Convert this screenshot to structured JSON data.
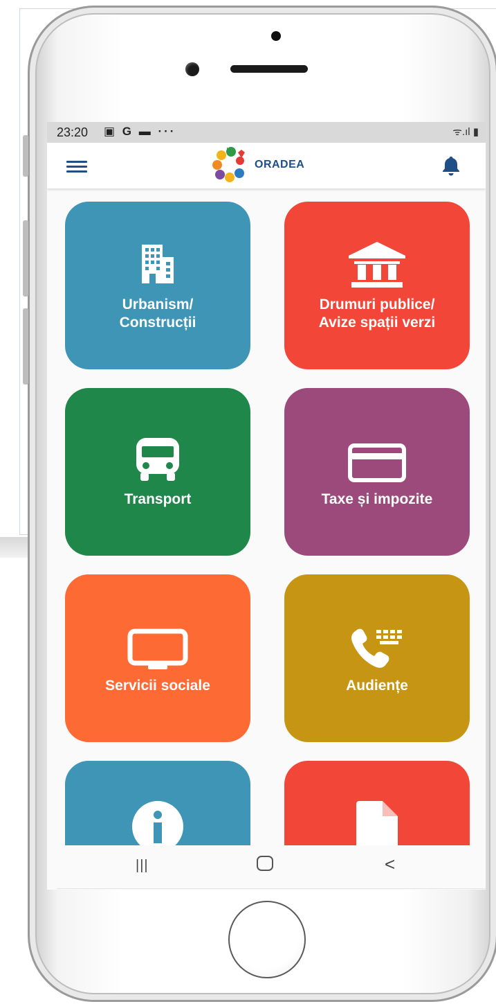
{
  "status_bar": {
    "time": "23:20",
    "left_icons": "▣ G ▬ ···",
    "right_icons": "ᯤ.ıl ▮"
  },
  "app_bar": {
    "logo_text": "ORADEA",
    "menu_icon": "hamburger-menu-icon",
    "notification_icon": "bell-icon"
  },
  "tiles": [
    {
      "line1": "Urbanism/",
      "line2": "Construcții",
      "icon": "buildings-icon",
      "color": "#3e95b5"
    },
    {
      "line1": "Drumuri publice/",
      "line2": "Avize spații verzi",
      "icon": "institution-icon",
      "color": "#f24638"
    },
    {
      "line1": "Transport",
      "line2": "",
      "icon": "bus-icon",
      "color": "#1f874a"
    },
    {
      "line1": "Taxe și impozite",
      "line2": "",
      "icon": "credit-card-icon",
      "color": "#9c4a7b"
    },
    {
      "line1": "Servicii sociale",
      "line2": "",
      "icon": "monitor-icon",
      "color": "#fd6a34"
    },
    {
      "line1": "Audiențe",
      "line2": "",
      "icon": "phone-keypad-icon",
      "color": "#c79514"
    },
    {
      "line1": "",
      "line2": "",
      "icon": "info-icon",
      "color": "#3e95b5"
    },
    {
      "line1": "",
      "line2": "",
      "icon": "document-icon",
      "color": "#f24638"
    }
  ],
  "nav_bar": {
    "recents": "|||",
    "home": "▢",
    "back": "<"
  }
}
